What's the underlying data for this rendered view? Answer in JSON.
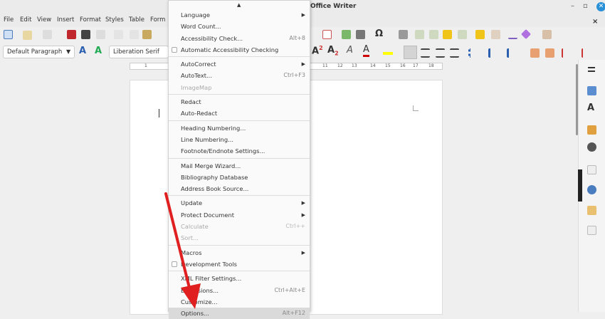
{
  "window": {
    "title": "Office Writer",
    "minimize": "–",
    "maximize": "▫",
    "close": "✕",
    "doc_close": "×"
  },
  "menubar": [
    "File",
    "Edit",
    "View",
    "Insert",
    "Format",
    "Styles",
    "Table",
    "Form"
  ],
  "toolbar": {
    "paragraph_style": "Default Paragraph",
    "font_name": "Liberation Serif"
  },
  "ruler": {
    "ticks": [
      "1",
      "11",
      "12",
      "13",
      "14",
      "15",
      "16",
      "17",
      "18"
    ]
  },
  "tools_menu": {
    "scroll_up": "▲",
    "items": [
      {
        "label": "Language",
        "submenu": true
      },
      {
        "label": "Word Count..."
      },
      {
        "label": "Accessibility Check...",
        "shortcut": "Alt+8"
      },
      {
        "label": "Automatic Accessibility Checking",
        "checkbox": true
      },
      {
        "sep": true
      },
      {
        "label": "AutoCorrect",
        "submenu": true
      },
      {
        "label": "AutoText...",
        "shortcut": "Ctrl+F3"
      },
      {
        "label": "ImageMap",
        "disabled": true
      },
      {
        "sep": true
      },
      {
        "label": "Redact"
      },
      {
        "label": "Auto-Redact"
      },
      {
        "sep": true
      },
      {
        "label": "Heading Numbering..."
      },
      {
        "label": "Line Numbering..."
      },
      {
        "label": "Footnote/Endnote Settings..."
      },
      {
        "sep": true
      },
      {
        "label": "Mail Merge Wizard..."
      },
      {
        "label": "Bibliography Database"
      },
      {
        "label": "Address Book Source..."
      },
      {
        "sep": true
      },
      {
        "label": "Update",
        "submenu": true
      },
      {
        "label": "Protect Document",
        "submenu": true
      },
      {
        "label": "Calculate",
        "shortcut": "Ctrl++",
        "disabled": true
      },
      {
        "label": "Sort...",
        "disabled": true
      },
      {
        "sep": true
      },
      {
        "label": "Macros",
        "submenu": true
      },
      {
        "label": "Development Tools",
        "checkbox": true
      },
      {
        "sep": true
      },
      {
        "label": "XML Filter Settings..."
      },
      {
        "label": "Extensions...",
        "shortcut": "Ctrl+Alt+E"
      },
      {
        "label": "Customize..."
      },
      {
        "label": "Options...",
        "shortcut": "Alt+F12",
        "highlighted": true
      }
    ]
  },
  "colors": {
    "annotation_arrow": "#e02020",
    "highlight": "#dadada",
    "accent": "#2a90d8"
  }
}
